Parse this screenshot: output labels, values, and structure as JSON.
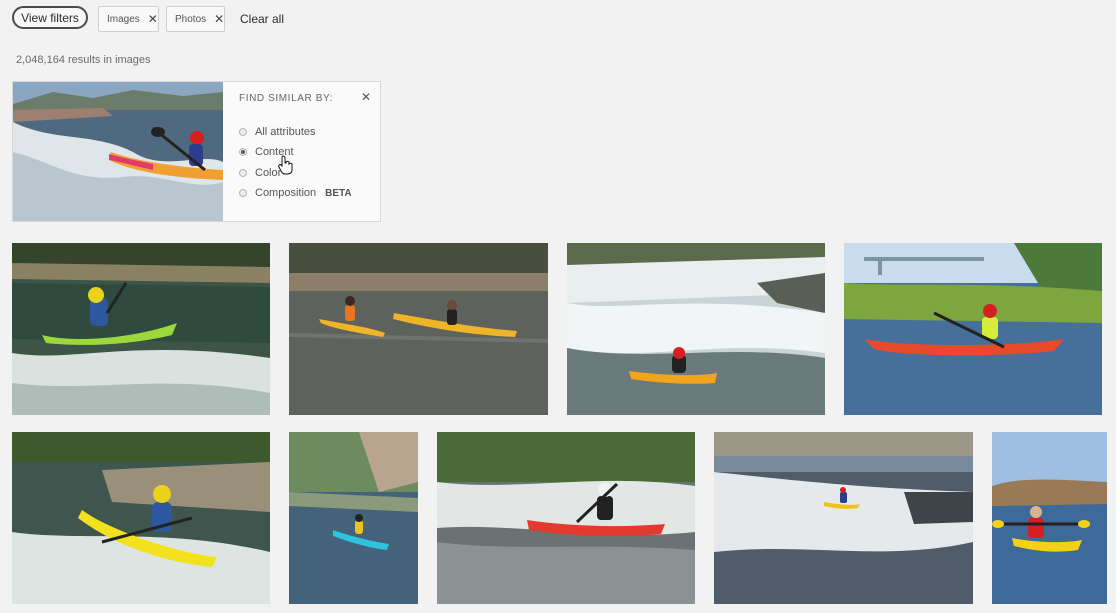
{
  "filter_bar": {
    "view_filters": "View filters",
    "chips": [
      {
        "label": "Images",
        "remove_icon": "close-icon"
      },
      {
        "label": "Photos",
        "remove_icon": "close-icon"
      }
    ],
    "clear_all": "Clear all"
  },
  "results": {
    "count_text": "2,048,164 results in images"
  },
  "find_similar": {
    "title": "FIND SIMILAR BY:",
    "close_icon": "close-icon",
    "options": [
      {
        "label": "All attributes",
        "selected": false
      },
      {
        "label": "Content",
        "selected": true
      },
      {
        "label": "Color",
        "selected": false
      },
      {
        "label": "Composition",
        "badge": "BETA",
        "selected": false
      }
    ]
  },
  "grid": {
    "rows": [
      [
        {
          "kind": "whitewater-kayak-yellow-helmet",
          "boat": "#9bd83a"
        },
        {
          "kind": "two-kayaks-calm-water",
          "boat": "#f0b428"
        },
        {
          "kind": "kayak-in-rapids",
          "boat": "#f4a31d"
        },
        {
          "kind": "kayak-on-lake-lily-pads",
          "boat": "#e84a2c"
        }
      ],
      [
        {
          "kind": "yellow-kayak-near-rocks",
          "boat": "#f1e21d"
        },
        {
          "kind": "kayak-river-forest",
          "boat": "#2ec4e0"
        },
        {
          "kind": "red-kayak-rapids",
          "boat": "#e23a2f"
        },
        {
          "kind": "kayak-far-whitewater",
          "boat": "#f0c21b"
        },
        {
          "kind": "yellow-kayak-lake",
          "boat": "#f4d016"
        }
      ]
    ]
  }
}
